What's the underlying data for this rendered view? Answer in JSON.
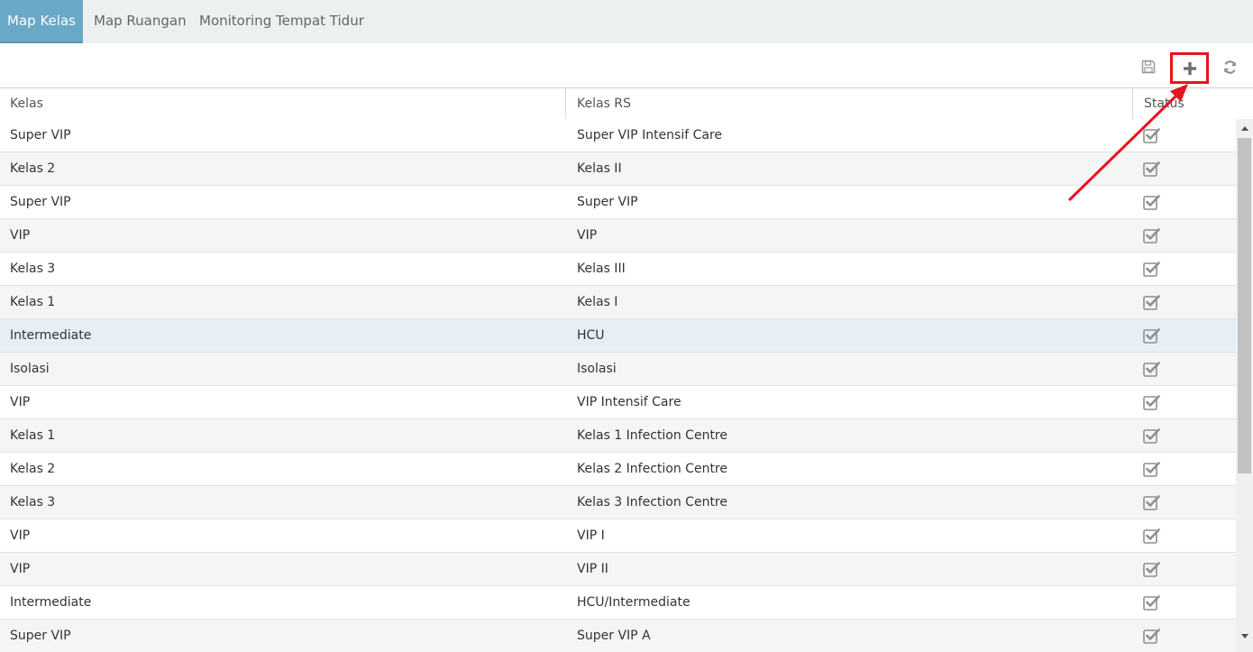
{
  "tabs": [
    {
      "label": "Map Kelas",
      "active": true
    },
    {
      "label": "Map Ruangan",
      "active": false
    },
    {
      "label": "Monitoring Tempat Tidur",
      "active": false
    }
  ],
  "toolbar": {
    "save_icon": "save-icon",
    "add_icon": "plus-icon",
    "refresh_icon": "refresh-icon",
    "highlight_color": "#e3161d"
  },
  "grid": {
    "columns": [
      "Kelas",
      "Kelas RS",
      "Status"
    ],
    "rows": [
      {
        "kelas": "Super VIP",
        "kelas_rs": "Super VIP Intensif Care",
        "status": true
      },
      {
        "kelas": "Kelas 2",
        "kelas_rs": "Kelas II",
        "status": true
      },
      {
        "kelas": "Super VIP",
        "kelas_rs": "Super VIP",
        "status": true
      },
      {
        "kelas": "VIP",
        "kelas_rs": "VIP",
        "status": true
      },
      {
        "kelas": "Kelas 3",
        "kelas_rs": "Kelas III",
        "status": true
      },
      {
        "kelas": "Kelas 1",
        "kelas_rs": "Kelas I",
        "status": true
      },
      {
        "kelas": "Intermediate",
        "kelas_rs": "HCU",
        "status": true,
        "selected": true
      },
      {
        "kelas": "Isolasi",
        "kelas_rs": "Isolasi",
        "status": true
      },
      {
        "kelas": "VIP",
        "kelas_rs": "VIP Intensif Care",
        "status": true
      },
      {
        "kelas": "Kelas 1",
        "kelas_rs": "Kelas 1 Infection Centre",
        "status": true
      },
      {
        "kelas": "Kelas 2",
        "kelas_rs": "Kelas 2 Infection Centre",
        "status": true
      },
      {
        "kelas": "Kelas 3",
        "kelas_rs": "Kelas 3 Infection Centre",
        "status": true
      },
      {
        "kelas": "VIP",
        "kelas_rs": "VIP I",
        "status": true
      },
      {
        "kelas": "VIP",
        "kelas_rs": "VIP II",
        "status": true
      },
      {
        "kelas": "Intermediate",
        "kelas_rs": "HCU/Intermediate",
        "status": true
      },
      {
        "kelas": "Super VIP",
        "kelas_rs": "Super VIP A",
        "status": true
      }
    ]
  },
  "colors": {
    "tab_active_bg": "#6aa8c8",
    "tabbar_bg": "#edf0f0",
    "row_selected_bg": "#e6eff6",
    "annotation": "#e3161d"
  }
}
